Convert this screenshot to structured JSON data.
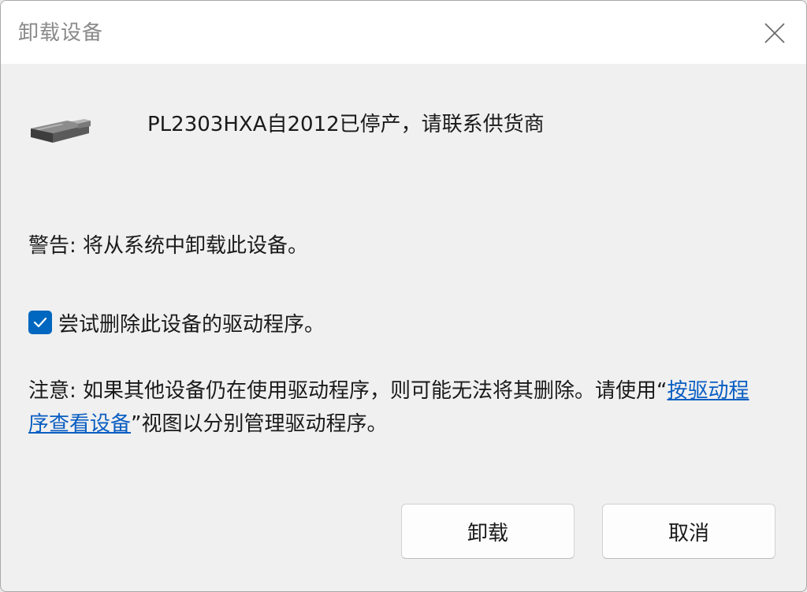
{
  "window": {
    "title": "卸载设备"
  },
  "device": {
    "name": "PL2303HXA自2012已停产，请联系供货商",
    "icon": "usb-device-icon"
  },
  "warning_text": "警告: 将从系统中卸载此设备。",
  "checkbox": {
    "label": "尝试删除此设备的驱动程序。",
    "checked": true,
    "accent_color": "#0067c0"
  },
  "note": {
    "prefix": "注意: 如果其他设备仍在使用驱动程序，则可能无法将其删除。请使用“",
    "link": "按驱动程序查看设备",
    "suffix": "”视图以分别管理驱动程序。"
  },
  "buttons": {
    "uninstall": "卸载",
    "cancel": "取消"
  }
}
